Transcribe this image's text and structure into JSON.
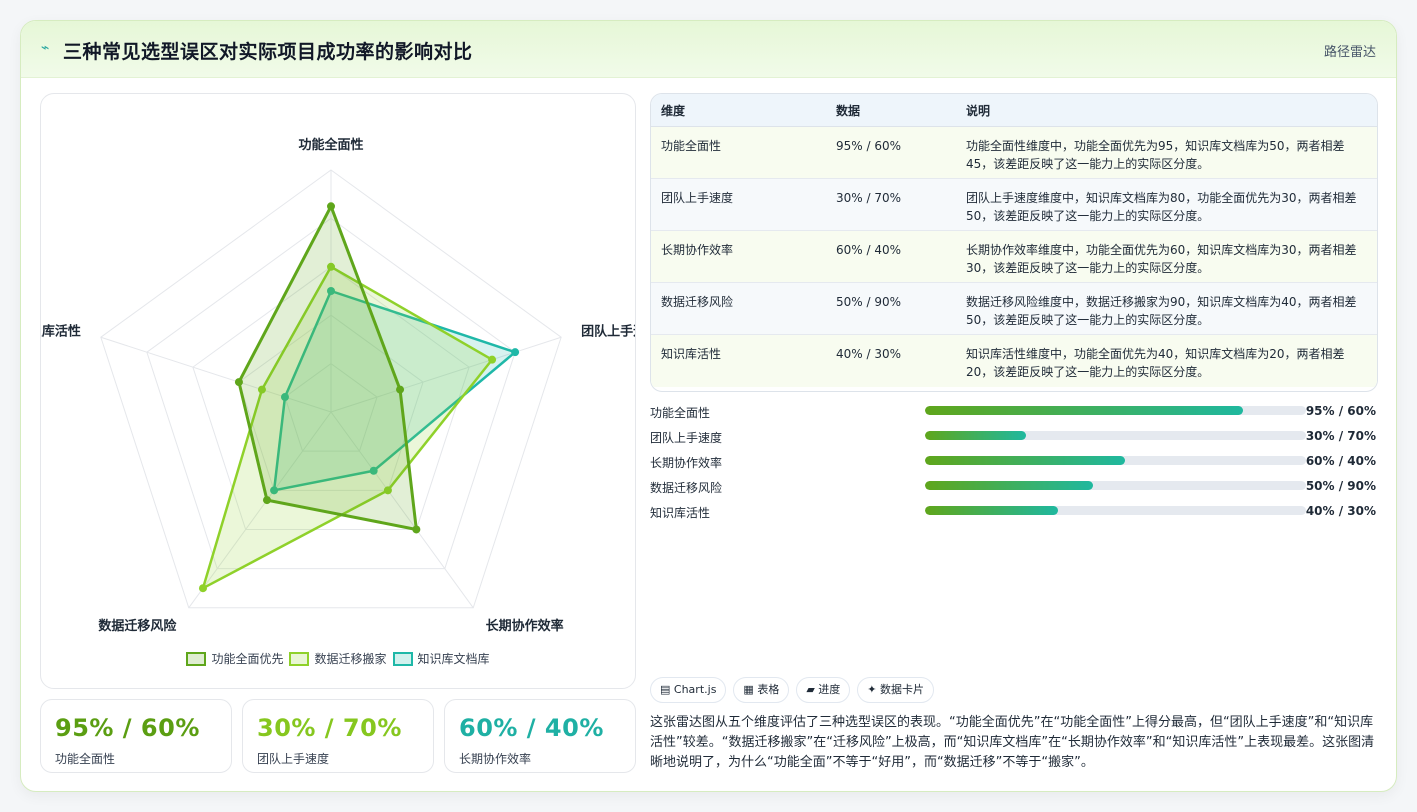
{
  "header": {
    "icon": "zap-icon",
    "title": "三种常见选型误区对实际项目成功率的影响对比",
    "tag": "路径雷达"
  },
  "chart_data": {
    "type": "radar",
    "axes": [
      "功能全面性",
      "团队上手速度",
      "长期协作效率",
      "数据迁移风险",
      "知识库活性"
    ],
    "range": [
      0,
      100
    ],
    "series": [
      {
        "name": "功能全面优先",
        "values": [
          85,
          30,
          60,
          45,
          40
        ],
        "color": "#5fa61b"
      },
      {
        "name": "数据迁移搬家",
        "values": [
          60,
          70,
          40,
          90,
          30
        ],
        "color": "#8fd12a"
      },
      {
        "name": "知识库文档库",
        "values": [
          50,
          80,
          30,
          40,
          20
        ],
        "color": "#1fb8a8"
      }
    ]
  },
  "stats": [
    {
      "value": "95% / 60%",
      "label": "功能全面性",
      "color": "#5b9e12"
    },
    {
      "value": "30% / 70%",
      "label": "团队上手速度",
      "color": "#86c71f"
    },
    {
      "value": "60% / 40%",
      "label": "长期协作效率",
      "color": "#1fb0a4"
    }
  ],
  "table": {
    "headers": [
      "维度",
      "数据",
      "说明"
    ],
    "rows": [
      {
        "dim": "功能全面性",
        "data": "95% / 60%",
        "note": "功能全面性维度中，功能全面优先为95，知识库文档库为50，两者相差45，该差距反映了这一能力上的实际区分度。"
      },
      {
        "dim": "团队上手速度",
        "data": "30% / 70%",
        "note": "团队上手速度维度中，知识库文档库为80，功能全面优先为30，两者相差50，该差距反映了这一能力上的实际区分度。"
      },
      {
        "dim": "长期协作效率",
        "data": "60% / 40%",
        "note": "长期协作效率维度中，功能全面优先为60，知识库文档库为30，两者相差30，该差距反映了这一能力上的实际区分度。"
      },
      {
        "dim": "数据迁移风险",
        "data": "50% / 90%",
        "note": "数据迁移风险维度中，数据迁移搬家为90，知识库文档库为40，两者相差50，该差距反映了这一能力上的实际区分度。"
      },
      {
        "dim": "知识库活性",
        "data": "40% / 30%",
        "note": "知识库活性维度中，功能全面优先为40，知识库文档库为20，两者相差20，该差距反映了这一能力上的实际区分度。"
      }
    ]
  },
  "bars": [
    {
      "label": "功能全面性",
      "value": "95% / 60%",
      "pct": 83.5
    },
    {
      "label": "团队上手速度",
      "value": "30% / 70%",
      "pct": 26.5
    },
    {
      "label": "长期协作效率",
      "value": "60% / 40%",
      "pct": 52.5
    },
    {
      "label": "数据迁移风险",
      "value": "50% / 90%",
      "pct": 44
    },
    {
      "label": "知识库活性",
      "value": "40% / 30%",
      "pct": 35
    }
  ],
  "chips": [
    {
      "icon": "chart-icon",
      "glyph": "▤",
      "label": "Chart.js"
    },
    {
      "icon": "table-icon",
      "glyph": "▦",
      "label": "表格"
    },
    {
      "icon": "progress-icon",
      "glyph": "▰",
      "label": "进度"
    },
    {
      "icon": "sparkle-icon",
      "glyph": "✦",
      "label": "数据卡片"
    }
  ],
  "description": "这张雷达图从五个维度评估了三种选型误区的表现。“功能全面优先”在“功能全面性”上得分最高，但“团队上手速度”和“知识库活性”较差。“数据迁移搬家”在“迁移风险”上极高，而“知识库文档库”在“长期协作效率”和“知识库活性”上表现最差。这张图清晰地说明了，为什么“功能全面”不等于“好用”，而“数据迁移”不等于“搬家”。"
}
